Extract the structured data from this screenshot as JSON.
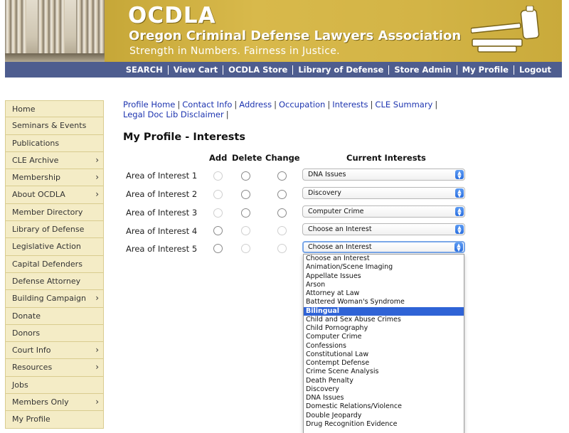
{
  "banner": {
    "short_name": "OCDLA",
    "long_name": "Oregon Criminal Defense Lawyers Association",
    "tagline": "Strength in Numbers. Fairness in Justice.",
    "logo_icon": "gavel-icon"
  },
  "topnav": [
    "SEARCH",
    "View Cart",
    "OCDLA Store",
    "Library of Defense",
    "Store Admin",
    "My Profile",
    "Logout"
  ],
  "sidebar": {
    "items": [
      {
        "label": "Home",
        "arrow": ""
      },
      {
        "label": "Seminars & Events",
        "arrow": ""
      },
      {
        "label": "Publications",
        "arrow": ""
      },
      {
        "label": "CLE Archive",
        "arrow": "›"
      },
      {
        "label": "Membership",
        "arrow": "›"
      },
      {
        "label": "About OCDLA",
        "arrow": "›"
      },
      {
        "label": "Member Directory",
        "arrow": ""
      },
      {
        "label": "Library of Defense",
        "arrow": ""
      },
      {
        "label": "Legislative Action",
        "arrow": ""
      },
      {
        "label": "Capital Defenders",
        "arrow": ""
      },
      {
        "label": "Defense Attorney",
        "arrow": ""
      },
      {
        "label": "Building Campaign",
        "arrow": "›"
      },
      {
        "label": "Donate",
        "arrow": ""
      },
      {
        "label": "Donors",
        "arrow": ""
      },
      {
        "label": "Court Info",
        "arrow": "›"
      },
      {
        "label": "Resources",
        "arrow": "›"
      },
      {
        "label": "Jobs",
        "arrow": ""
      },
      {
        "label": "Members Only",
        "arrow": "›"
      },
      {
        "label": "My Profile",
        "arrow": ""
      }
    ]
  },
  "subnav": {
    "links": [
      "Profile Home",
      "Contact Info",
      "Address",
      "Occupation",
      "Interests",
      "CLE Summary",
      "Legal Doc Lib Disclaimer"
    ],
    "separator": "|"
  },
  "page_title": "My Profile - Interests",
  "table": {
    "headers": {
      "add": "Add",
      "delete": "Delete",
      "change": "Change",
      "current": "Current Interests"
    },
    "rows": [
      {
        "label": "Area of Interest 1",
        "value": "DNA Issues"
      },
      {
        "label": "Area of Interest 2",
        "value": "Discovery"
      },
      {
        "label": "Area of Interest 3",
        "value": "Computer Crime"
      },
      {
        "label": "Area of Interest 4",
        "value": "Choose an Interest"
      },
      {
        "label": "Area of Interest 5",
        "value": "Choose an Interest"
      }
    ]
  },
  "dropdown": {
    "selected": "Bilingual",
    "options": [
      "Choose an Interest",
      "Animation/Scene Imaging",
      "Appellate Issues",
      "Arson",
      "Attorney at Law",
      "Battered Woman's Syndrome",
      "Bilingual",
      "Child and Sex Abuse Crimes",
      "Child Pornography",
      "Computer Crime",
      "Confessions",
      "Constitutional Law",
      "Contempt Defense",
      "Crime Scene Analysis",
      "Death Penalty",
      "Discovery",
      "DNA Issues",
      "Domestic Relations/Violence",
      "Double Jeopardy",
      "Drug Recognition Evidence"
    ]
  },
  "colors": {
    "banner_gold": "#d3b446",
    "nav_blue": "#4e5d8f",
    "sidebar_bg": "#f4ecc6",
    "link_blue": "#1e35b0",
    "selection_blue": "#2f63d6"
  }
}
